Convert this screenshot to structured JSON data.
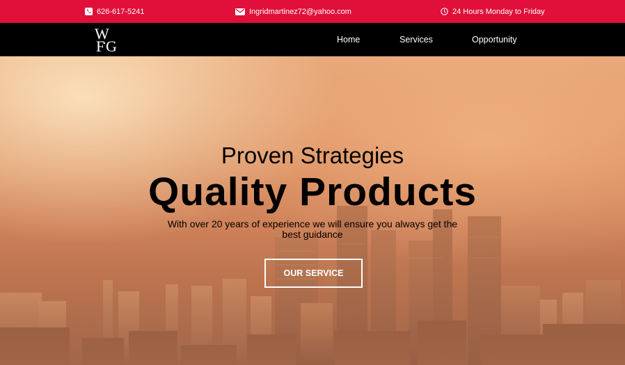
{
  "topbar": {
    "phone": "626-617-5241",
    "email": "Ingridmartinez72@yahoo.com",
    "hours": "24 Hours Monday to Friday",
    "background": "#e0103a"
  },
  "nav": {
    "logo_text": "WFG",
    "items": [
      {
        "label": "Home"
      },
      {
        "label": "Services"
      },
      {
        "label": "Opportunity"
      }
    ]
  },
  "hero": {
    "subtitle": "Proven Strategies",
    "title": "Quality Products",
    "description": "With over 20 years of experience we will ensure you always get the best guidance",
    "button_label": "OUR SERVICE"
  },
  "icons": {
    "phone": "phone-icon",
    "email": "envelope-icon",
    "hours": "clock-icon"
  }
}
